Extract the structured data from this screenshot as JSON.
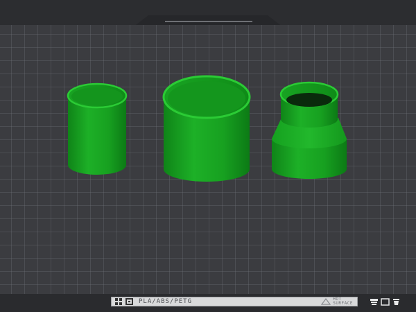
{
  "viewport": {
    "bed_color": "#3b3c40",
    "grid_color": "#6e7076",
    "frame_color": "#2c2d30"
  },
  "models": [
    {
      "name": "straight-cylinder",
      "color": "#16a21e"
    },
    {
      "name": "wide-cylinder",
      "color": "#16a21e"
    },
    {
      "name": "stepped-reducer",
      "color": "#16a21e"
    }
  ],
  "status_bar": {
    "material": "PLA/ABS/PETG",
    "surface_tag_line1": "HOT",
    "surface_tag_line2": "SURFACE",
    "left_icons": [
      "view-grid-icon",
      "view-frame-icon"
    ],
    "warning_icon": "warning-triangle-icon"
  },
  "tool_icons": [
    "layers-icon",
    "frame-icon",
    "trash-icon"
  ]
}
